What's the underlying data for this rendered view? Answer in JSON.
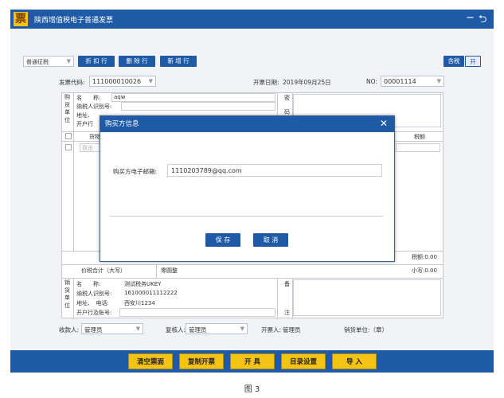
{
  "app": {
    "logo_char": "票",
    "title": "陕西增值税电子普通发票",
    "minimize": "−",
    "back": "⮌"
  },
  "toolbar": {
    "invoice_type": "普通征税",
    "btn_discount": "折 扣 行",
    "btn_delete": "删 除 行",
    "btn_add": "新 增 行",
    "tax_incl_label": "含税",
    "tax_incl_toggle": "开"
  },
  "header": {
    "code_label": "发票代码:",
    "code_value": "111000010026",
    "date_label": "开票日期:",
    "date_value": "2019年09月25日",
    "no_label": "NO:",
    "no_value": "00001114"
  },
  "buyer": {
    "side_label_1": "购",
    "side_label_2": "货",
    "side_label_3": "单",
    "side_label_4": "位",
    "name_label": "名　　称:",
    "name_value": "aqw",
    "taxid_label": "纳税人识别号:",
    "addr_label": "地址、",
    "bank_label": "开户行",
    "mark_1": "密",
    "mark_2": "码"
  },
  "items": {
    "goods_label": "货物",
    "hint": "双击",
    "tax_label": "税额"
  },
  "totals": {
    "tax_total": "税额:0.00",
    "total_cn_label": "价税合计（大写）",
    "total_cn_value": "零圆整",
    "total_small": "小写:0.00"
  },
  "seller": {
    "side_label_1": "销",
    "side_label_2": "货",
    "side_label_3": "单",
    "side_label_4": "位",
    "name_label": "名　　称:",
    "name_value": "测试税务UKEY",
    "taxid_label": "纳税人识别号:",
    "taxid_value": "161000011112222",
    "addr_label": "地址、　电话:",
    "addr_value": "西安川1234",
    "bank_label": "开户行及账号:",
    "remark_1": "备",
    "remark_2": "注"
  },
  "signers": {
    "payee_label": "收款人:",
    "payee_value": "管理员",
    "reviewer_label": "复核人:",
    "reviewer_value": "管理员",
    "drawer_label": "开票人:",
    "drawer_value": "管理员",
    "seller_seal": "销货单位:（章）"
  },
  "dialog": {
    "title": "购买方信息",
    "close": "✕",
    "email_label": "购买方电子邮箱:",
    "email_value": "1110203789@qq.com",
    "save": "保 存",
    "cancel": "取 消"
  },
  "footer": {
    "clear": "清空票面",
    "copy": "复制开票",
    "issue": "开 具",
    "catalog": "目录设置",
    "import": "导 入"
  },
  "caption": "图 3"
}
